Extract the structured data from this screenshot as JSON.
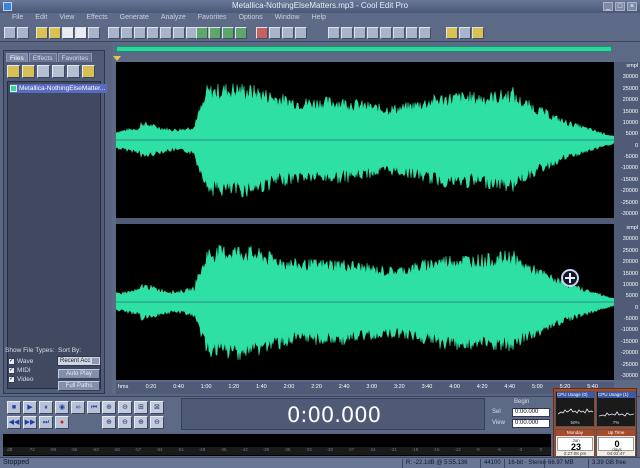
{
  "window": {
    "title": "Metallica-NothingElseMatters.mp3 - Cool Edit Pro",
    "minimize": "_",
    "maximize": "□",
    "close": "×"
  },
  "menu": [
    "File",
    "Edit",
    "View",
    "Effects",
    "Generate",
    "Analyze",
    "Favorites",
    "Options",
    "Window",
    "Help"
  ],
  "file_panel": {
    "tabs": [
      "Files",
      "Effects",
      "Favorites"
    ],
    "active_tab": "Files",
    "files": [
      "Metallica-NothingElseMatter..."
    ],
    "show_types_label": "Show File Types:",
    "types": [
      {
        "label": "Wave",
        "checked": true
      },
      {
        "label": "MIDI",
        "checked": true
      },
      {
        "label": "Video",
        "checked": true
      }
    ],
    "sort_label": "Sort By:",
    "sort_value": "Recent Acc",
    "auto_play": "Auto Play",
    "full_paths": "Full Paths"
  },
  "waveform": {
    "db_labels_top": [
      "smpl",
      "30000",
      "25000",
      "20000",
      "15000",
      "10000",
      "5000",
      "0",
      "-5000",
      "-10000",
      "-15000",
      "-20000",
      "-25000",
      "-30000"
    ],
    "db_labels_bottom": [
      "smpl",
      "30000",
      "25000",
      "20000",
      "15000",
      "10000",
      "5000",
      "0",
      "-5000",
      "-10000",
      "-15000",
      "-20000",
      "-25000",
      "-30000"
    ],
    "time_labels": [
      "hms",
      "0:20",
      "0:40",
      "1:00",
      "1:20",
      "1:40",
      "2:00",
      "2:20",
      "2:40",
      "3:00",
      "3:20",
      "3:40",
      "4:00",
      "4:20",
      "4:40",
      "5:00",
      "5:20",
      "5:40"
    ],
    "wave_color": "#2ee0a4"
  },
  "transport": {
    "buttons": [
      "■",
      "▶",
      "⏸",
      "◉",
      "∞",
      "",
      "⏮",
      "◀◀",
      "▶▶",
      "⏭",
      "●",
      ""
    ],
    "zoom_buttons": [
      "⊕",
      "⊖",
      "⊞",
      "⊠",
      "⊕",
      "⊖",
      "⊕",
      "⊖"
    ],
    "time": "0:00.000",
    "begin_label": "Begin",
    "sel_label": "Sel",
    "view_label": "View",
    "sel_value": "0:00.000",
    "view_value": "0:00.000"
  },
  "widgets": {
    "cpu1_title": "CPU Usage (0)",
    "cpu1_pct": "50%",
    "cpu2_title": "CPU Usage (1)",
    "cpu2_pct": "7%",
    "calendar_weekday": "Monday",
    "calendar_month": "Jun",
    "calendar_day": "23",
    "calendar_time": "2:27:08 pm",
    "uptime_label": "Up Time",
    "uptime_days": "0",
    "uptime_unit": "days",
    "uptime_time": "04:02:47"
  },
  "level_meter": {
    "ticks": [
      "dB",
      "-72",
      "-69",
      "-66",
      "-63",
      "-60",
      "-57",
      "-54",
      "-51",
      "-48",
      "-45",
      "-42",
      "-39",
      "-36",
      "-33",
      "-30",
      "-27",
      "-24",
      "-21",
      "-18",
      "-15",
      "-12",
      "-9",
      "-6",
      "-3",
      "0"
    ]
  },
  "status": {
    "text": "Stopped",
    "level": "R: -22.1dB @ 5:55.136",
    "rate": "44100",
    "format": "16-bit · Stereo",
    "size": "66.97 MB",
    "free": "3.39 GB free"
  }
}
